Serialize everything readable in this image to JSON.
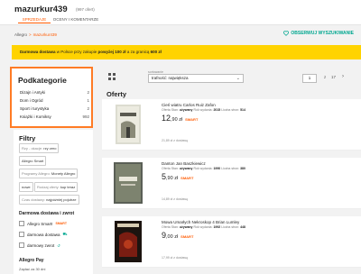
{
  "header": {
    "seller": "mazurkur439",
    "seller_count": "(997 ofert)",
    "tabs": [
      "SPRZEDAJE",
      "OCENY I KOMENTARZE"
    ]
  },
  "breadcrumb": {
    "root": "Allegro",
    "separator": ">",
    "current": "mazurkur439"
  },
  "watch_label": "OBSERWUJ WYSZUKIWANIE",
  "banner": {
    "prefix": "Darmowa dostawa",
    "middle": " w Polsce przy zakupie ",
    "bold1": "powyżej 100 zł",
    "middle2": " a za granicą ",
    "bold2": "600 zł"
  },
  "subcategories": {
    "title": "Podkategorie",
    "items": [
      {
        "label": "Dizajn i Antyki",
        "count": "2"
      },
      {
        "label": "Dom i Ogród",
        "count": "1"
      },
      {
        "label": "Sport i turystyka",
        "count": "2"
      },
      {
        "label": "Książki i Komiksy",
        "count": "992"
      }
    ]
  },
  "filters": {
    "title": "Filtry",
    "chips": [
      {
        "label": "Rzy - okacje:",
        "value": "rzy zero"
      },
      {
        "label": "",
        "value": "Allegro Smart"
      },
      {
        "label": "Programy Allegro:",
        "value": "Monety Allegro"
      },
      {
        "label": "",
        "value": "nowe"
      },
      {
        "label": "Rodzaj oferty:",
        "value": "kup teraz"
      },
      {
        "label": "Czas dostawy:",
        "value": "najpóźniej pojutrze"
      }
    ],
    "delivery_title": "Darmowa dostawa i zwrot",
    "checkboxes": [
      {
        "label": "Allegro Smart!",
        "badge": "SMART"
      },
      {
        "label": "darmowa dostawa",
        "badge": ""
      },
      {
        "label": "darmowy zwrot",
        "badge": ""
      }
    ],
    "pay_title": "Allegro Pay",
    "pay_note": "Zapłać za 30 dni"
  },
  "toolbar": {
    "sort_label": "sortowanie",
    "sort_value": "trafność: największa",
    "page": "1",
    "of": "z",
    "total": "17"
  },
  "offers_title": "Oferty",
  "offers": [
    {
      "title": "Cień wiatru Carlos Ruiz Zafon",
      "meta_label": "Oferta",
      "meta_1": "Stan:",
      "meta_1v": "używany",
      "meta_2": "Rok wydania:",
      "meta_2v": "2015",
      "meta_3": "Liczba stron:",
      "meta_3v": "514",
      "price_int": "12",
      "price_dec": ",90 zł",
      "smart": "SMART",
      "shipping": "21,89 zł z dostawą"
    },
    {
      "title": "Danton Jan Baszkiewicz",
      "meta_label": "Oferta",
      "meta_1": "Stan:",
      "meta_1v": "używany",
      "meta_2": "Rok wydania:",
      "meta_2v": "1990",
      "meta_3": "Liczba stron:",
      "meta_3v": "380",
      "price_int": "5",
      "price_dec": ",90 zł",
      "smart": "SMART",
      "shipping": "14,89 zł z dostawą"
    },
    {
      "title": "Mowa Umarłych Nekroskop 4 Brian Lumley",
      "meta_label": "Oferta",
      "meta_1": "Stan:",
      "meta_1v": "używany",
      "meta_2": "Rok wydania:",
      "meta_2v": "1992",
      "meta_3": "Liczba stron:",
      "meta_3v": "448",
      "price_int": "9",
      "price_dec": ",00 zł",
      "smart": "SMART",
      "shipping": "17,99 zł z dostawą"
    }
  ],
  "colors": {
    "accent": "#ff5a00",
    "highlight": "#ff7b24",
    "banner": "#ffd300",
    "teal": "#00a790"
  }
}
